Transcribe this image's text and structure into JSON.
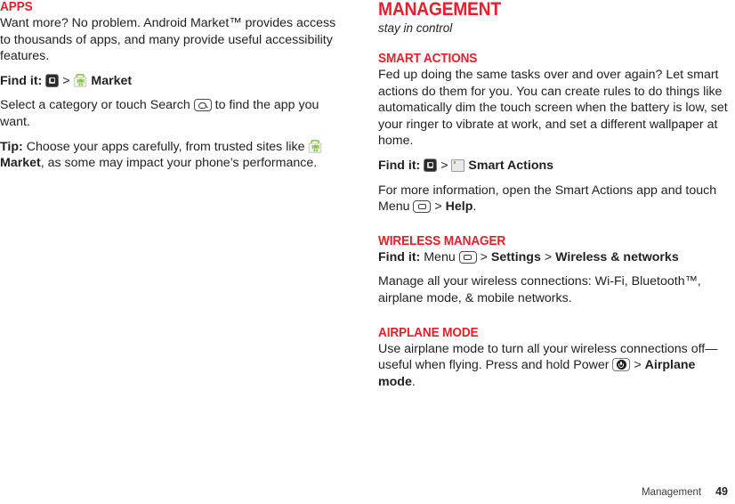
{
  "page": {
    "footer_section": "Management",
    "footer_page_number": "49",
    "accent_color": "#e5202e",
    "text_color": "#231f20"
  },
  "left_column": {
    "heading": "Apps",
    "paragraphs": {
      "intro": "Want more? No problem. Android Market™ provides access to thousands of apps, and many provide useful accessibility features.",
      "find_it_label": "Find it:",
      "find_it_separator": ">",
      "find_it_target": "Market",
      "select_pre": "Select a category or touch Search",
      "select_post": "to find the app you want.",
      "tip_label": "Tip:",
      "tip_pre": "Choose your apps carefully, from trusted sites like",
      "tip_bold": "Market",
      "tip_post": ", as some may impact your phone’s performance."
    },
    "icons": {
      "apps_tray": "apps-tray-icon",
      "market": "android-market-icon",
      "search_key": "search-key-icon"
    }
  },
  "right_column": {
    "section_title": "Management",
    "section_subtitle": "stay in control",
    "smart_actions": {
      "heading": "Smart Actions",
      "body": "Fed up doing the same tasks over and over again? Let smart actions do them for you. You can create rules to do things like automatically dim the touch screen when the battery is low, set your ringer to vibrate at work, and set a different wallpaper at home.",
      "find_it_label": "Find it:",
      "find_it_separator": ">",
      "find_it_target": "Smart Actions",
      "more_pre": "For more information, open the Smart Actions app and touch Menu",
      "more_sep": ">",
      "more_bold": "Help",
      "more_post": "."
    },
    "wireless_manager": {
      "heading": "Wireless Manager",
      "find_it_label": "Find it:",
      "find_it_menu": "Menu",
      "sep1": ">",
      "find_it_settings": "Settings",
      "sep2": ">",
      "find_it_target": "Wireless & networks",
      "body": "Manage all your wireless connections: Wi-Fi, Bluetooth™, airplane mode, & mobile networks."
    },
    "airplane_mode": {
      "heading": "Airplane Mode",
      "body_pre": "Use airplane mode to turn all your wireless connections off—useful when flying. Press and hold Power",
      "sep": ">",
      "bold": "Airplane mode",
      "post": "."
    },
    "icons": {
      "apps_tray": "apps-tray-icon",
      "smart_actions": "smart-actions-icon",
      "menu_key": "menu-key-icon",
      "power_key": "power-key-icon"
    }
  }
}
